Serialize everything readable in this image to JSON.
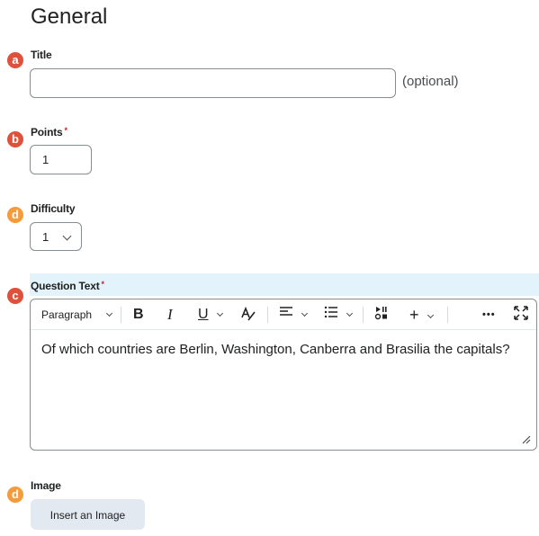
{
  "section_title": "General",
  "markers": {
    "title": "a",
    "points": "b",
    "difficulty": "d",
    "question_text": "c",
    "image": "d"
  },
  "title_field": {
    "label": "Title",
    "value": "",
    "suffix": "(optional)"
  },
  "points_field": {
    "label": "Points",
    "required_mark": "*",
    "value": "1"
  },
  "difficulty_field": {
    "label": "Difficulty",
    "selected": "1"
  },
  "question_text": {
    "label": "Question Text",
    "required_mark": "*",
    "toolbar": {
      "paragraph_label": "Paragraph",
      "bold": "B",
      "italic": "I",
      "underline": "U",
      "insert": "+",
      "more": "•••"
    },
    "content": "Of which countries are Berlin, Washington, Canberra and Brasilia the capitals?"
  },
  "image": {
    "label": "Image",
    "button_label": "Insert an Image"
  },
  "colors": {
    "marker_red": "#e0513c",
    "marker_orange": "#f59b3a",
    "highlight_band": "#e3f3fb",
    "button_bg": "#e3e9f1"
  }
}
